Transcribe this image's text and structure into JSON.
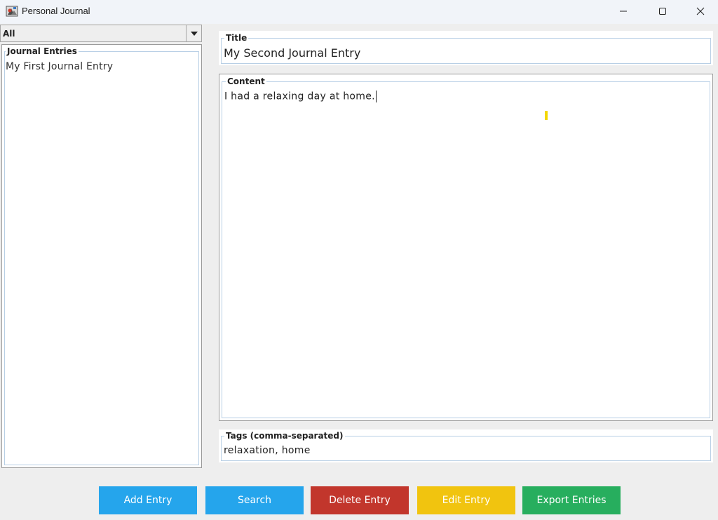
{
  "window": {
    "title": "Personal Journal",
    "icon": "java-app-icon"
  },
  "filter": {
    "selected": "All"
  },
  "entries_panel": {
    "legend": "Journal Entries",
    "items": [
      "My First Journal Entry"
    ]
  },
  "title_field": {
    "legend": "Title",
    "value": "My Second Journal Entry"
  },
  "content_field": {
    "legend": "Content",
    "value": "I had a relaxing day at home."
  },
  "tags_field": {
    "legend": "Tags (comma-separated)",
    "value": "relaxation, home"
  },
  "buttons": {
    "add": {
      "label": "Add Entry",
      "color": "#25a5ec"
    },
    "search": {
      "label": "Search",
      "color": "#25a5ec"
    },
    "delete": {
      "label": "Delete Entry",
      "color": "#c2362c"
    },
    "edit": {
      "label": "Edit Entry",
      "color": "#f1c40f"
    },
    "export": {
      "label": "Export Entries",
      "color": "#27ae5e"
    }
  },
  "icons": {
    "minimize": "minimize-icon",
    "maximize": "maximize-icon",
    "close": "close-icon",
    "dropdown": "dropdown-arrow-icon"
  }
}
